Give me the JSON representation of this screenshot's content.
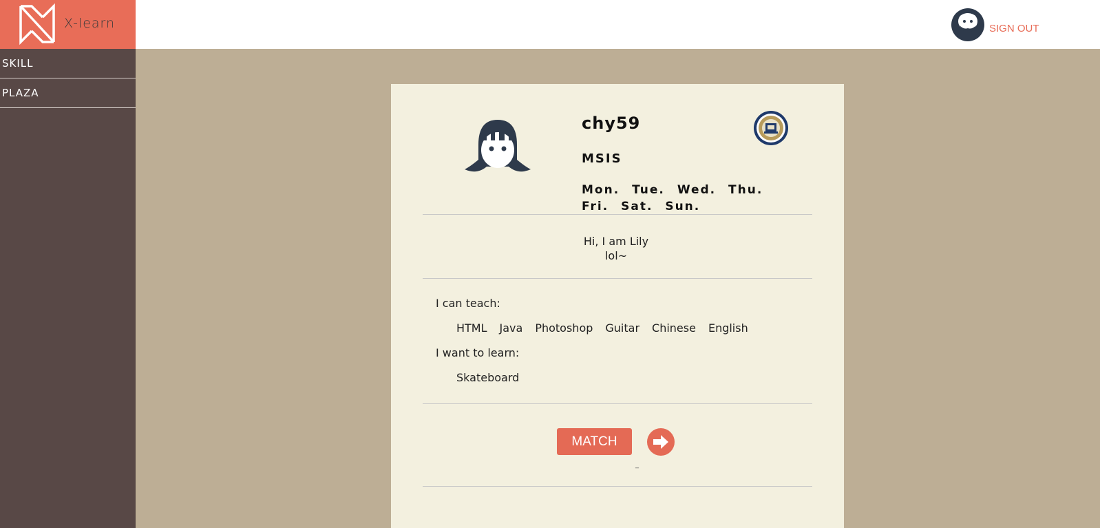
{
  "app": {
    "logo_text": "X-learn",
    "brand_color": "#e86d58"
  },
  "header": {
    "signout_label": "SIGN OUT",
    "avatar_icon": "bearded-man-avatar-icon"
  },
  "sidebar": {
    "items": [
      {
        "label": "SKILL"
      },
      {
        "label": "PLAZA"
      }
    ]
  },
  "profile": {
    "username": "chy59",
    "major": "MSIS",
    "days": "Mon. Tue. Wed. Thu. Fri. Sat. Sun.",
    "avatar_icon": "girl-avatar-icon",
    "badge_icon": "university-seal-icon",
    "bio_line1": "Hi, I am Lily",
    "bio_line2": "lol~",
    "teach_label": "I can teach:",
    "teach_skills": [
      "HTML",
      "Java",
      "Photoshop",
      "Guitar",
      "Chinese",
      "English"
    ],
    "learn_label": "I want to learn:",
    "learn_skills": [
      "Skateboard"
    ],
    "match_label": "MATCH",
    "next_icon": "arrow-right-circle-icon",
    "tiny_mark": "_"
  }
}
